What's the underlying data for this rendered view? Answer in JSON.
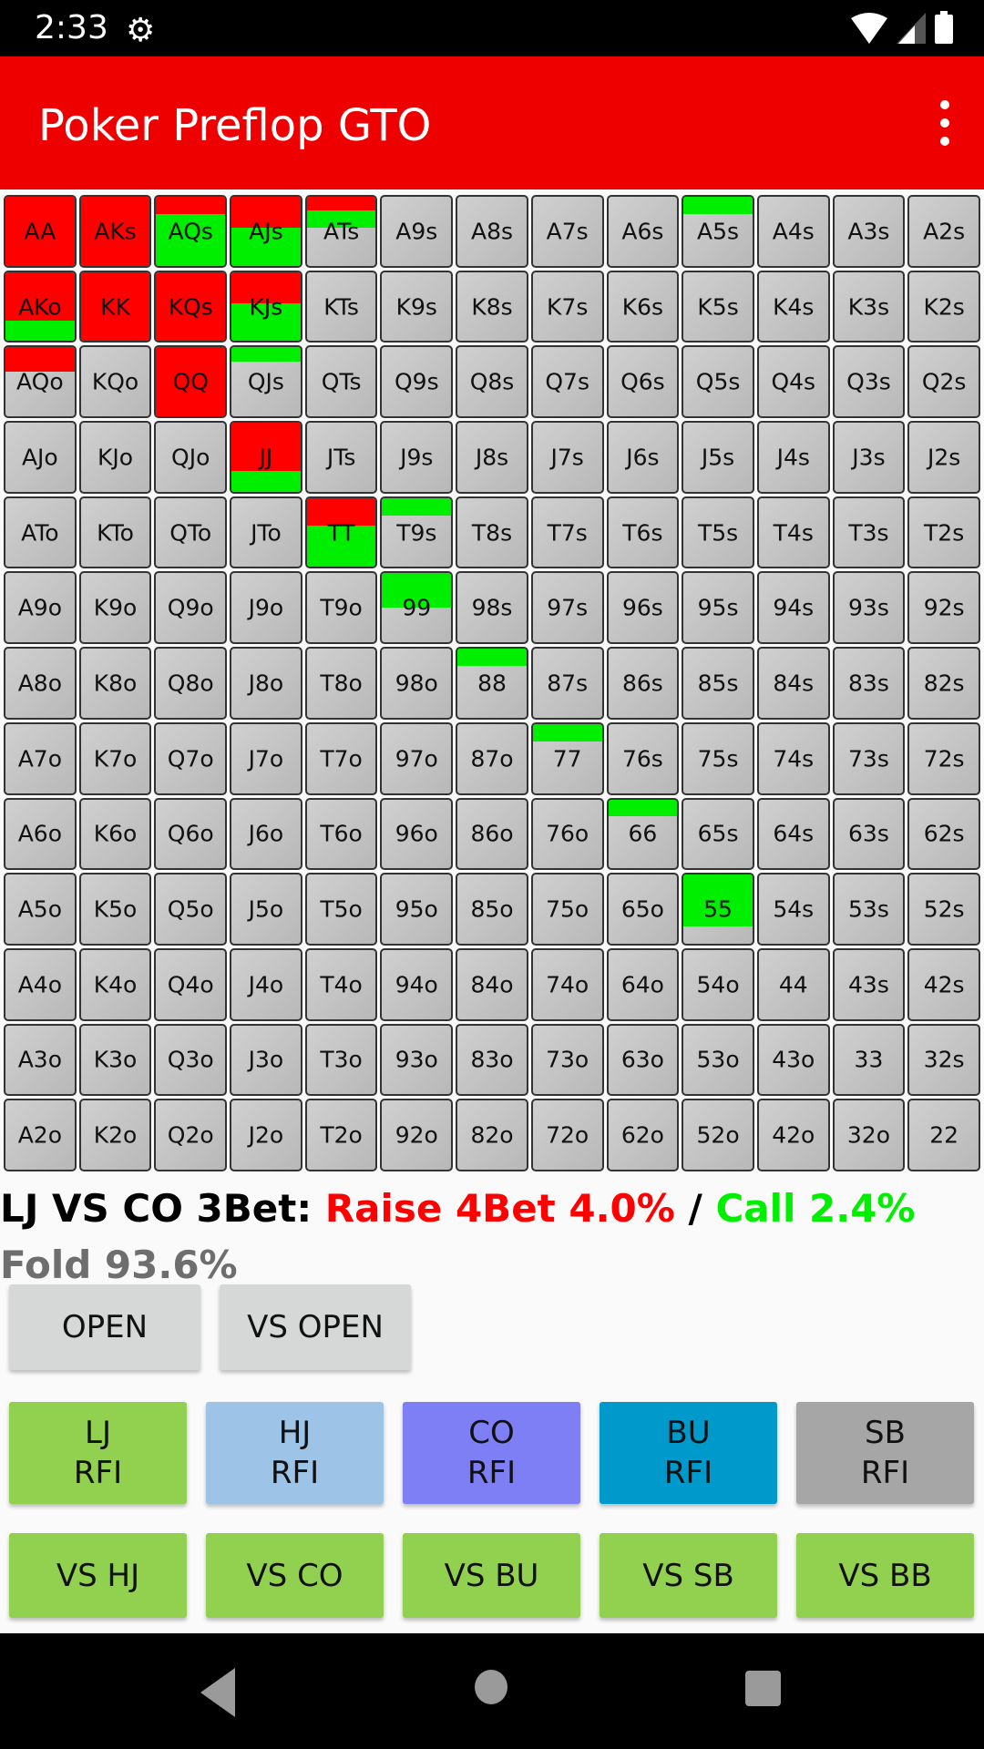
{
  "status_bar": {
    "time": "2:33",
    "settings_icon": "gear-icon",
    "wifi_icon": "wifi-icon",
    "signal_icon": "signal-icon",
    "battery_icon": "battery-icon"
  },
  "app_bar": {
    "title": "Poker Preflop GTO",
    "menu_icon": "overflow-menu-icon"
  },
  "colors": {
    "raise": "#ff0000",
    "call": "#00ee00",
    "fold": "#c4c4c4",
    "app_bar": "#ee0000"
  },
  "ranks": [
    "A",
    "K",
    "Q",
    "J",
    "T",
    "9",
    "8",
    "7",
    "6",
    "5",
    "4",
    "3",
    "2"
  ],
  "hand_strategy": {
    "AA": {
      "raise": 100,
      "call": 0
    },
    "AKs": {
      "raise": 100,
      "call": 0
    },
    "AQs": {
      "raise": 25,
      "call": 75
    },
    "AJs": {
      "raise": 45,
      "call": 55
    },
    "ATs": {
      "raise": 20,
      "call": 25
    },
    "A5s": {
      "raise": 0,
      "call": 25
    },
    "AKo": {
      "raise": 70,
      "call": 30
    },
    "KK": {
      "raise": 100,
      "call": 0
    },
    "KQs": {
      "raise": 100,
      "call": 0
    },
    "KJs": {
      "raise": 45,
      "call": 55
    },
    "AQo": {
      "raise": 35,
      "call": 0
    },
    "QQ": {
      "raise": 100,
      "call": 0
    },
    "QJs": {
      "raise": 0,
      "call": 20
    },
    "JJ": {
      "raise": 70,
      "call": 30
    },
    "TT": {
      "raise": 40,
      "call": 60
    },
    "T9s": {
      "raise": 0,
      "call": 25
    },
    "99": {
      "raise": 0,
      "call": 50
    },
    "88": {
      "raise": 0,
      "call": 25
    },
    "77": {
      "raise": 0,
      "call": 25
    },
    "66": {
      "raise": 0,
      "call": 25
    },
    "55": {
      "raise": 0,
      "call": 75
    }
  },
  "summary": {
    "scenario": "LJ VS CO 3Bet: ",
    "raise": "Raise 4Bet 4.0%",
    "separator": " / ",
    "call": "Call 2.4%",
    "fold": "Fold 93.6%"
  },
  "mode_buttons": [
    {
      "label": "OPEN"
    },
    {
      "label": "VS OPEN"
    }
  ],
  "position_buttons": [
    {
      "label": "LJ\nRFI",
      "color": "#92d050"
    },
    {
      "label": "HJ\nRFI",
      "color": "#9dc3e6"
    },
    {
      "label": "CO\nRFI",
      "color": "#7f7ff5"
    },
    {
      "label": "BU\nRFI",
      "color": "#0099cc"
    },
    {
      "label": "SB\nRFI",
      "color": "#a6a6a6"
    }
  ],
  "vs_buttons": [
    {
      "label": "VS HJ"
    },
    {
      "label": "VS CO"
    },
    {
      "label": "VS BU"
    },
    {
      "label": "VS SB"
    },
    {
      "label": "VS BB"
    }
  ],
  "nav_bar": {
    "back_icon": "back-icon",
    "home_icon": "home-icon",
    "recents_icon": "recents-icon"
  }
}
